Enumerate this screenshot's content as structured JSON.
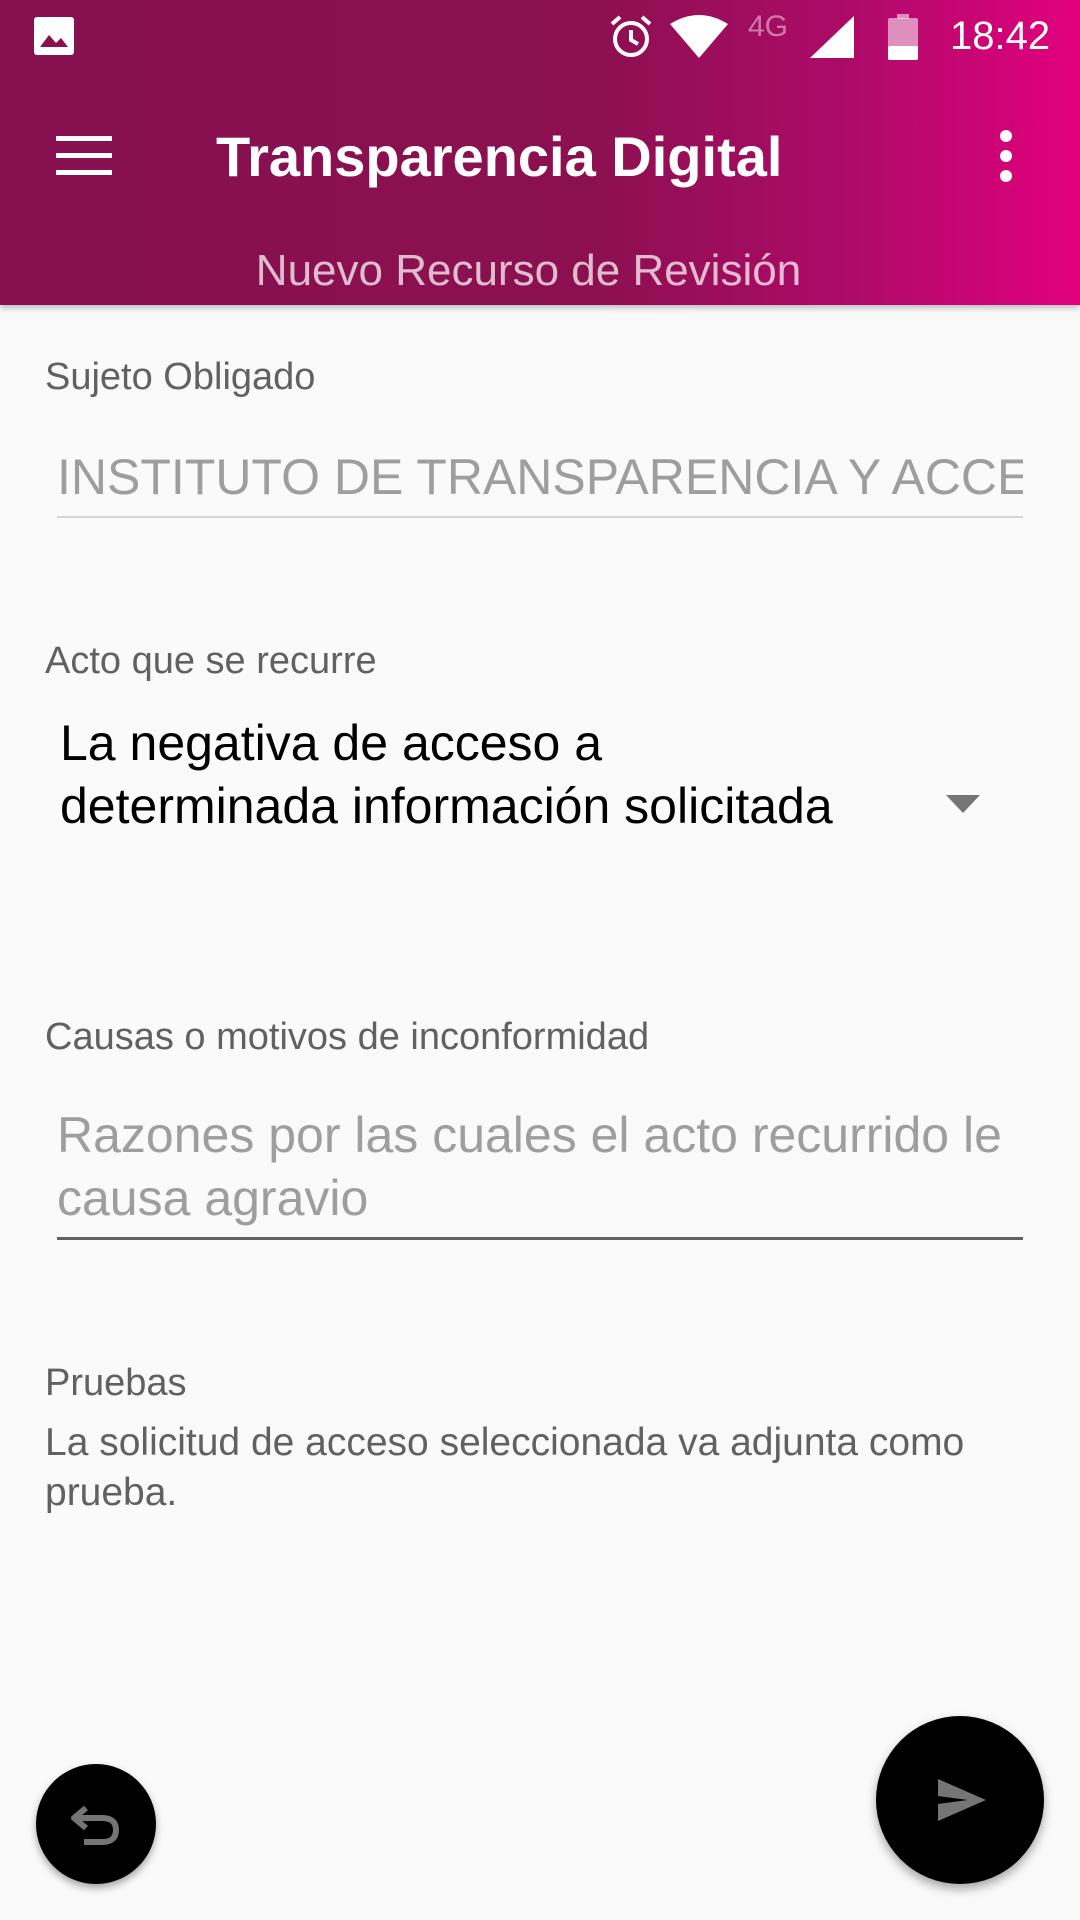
{
  "status_bar": {
    "network_type": "4G",
    "time": "18:42",
    "icons": [
      "gallery-icon",
      "alarm-icon",
      "wifi-icon",
      "signal-icon",
      "battery-icon"
    ]
  },
  "app_bar": {
    "title": "Transparencia Digital",
    "subtitle": "Nuevo Recurso de Revisión",
    "gradient_colors": [
      "#861050",
      "#e2007e"
    ]
  },
  "form": {
    "sujeto": {
      "label": "Sujeto Obligado",
      "value": "INSTITUTO DE TRANSPARENCIA Y ACCE"
    },
    "acto": {
      "label": "Acto que se recurre",
      "selected": "La negativa de acceso a determinada información solicitada"
    },
    "causas": {
      "label": "Causas o motivos de inconformidad",
      "placeholder": "Razones por las cuales el acto recurrido le causa agravio"
    },
    "pruebas": {
      "label": "Pruebas",
      "text": "La solicitud de acceso seleccionada va adjunta como prueba."
    }
  },
  "actions": {
    "back_icon": "undo-icon",
    "send_icon": "send-icon"
  }
}
